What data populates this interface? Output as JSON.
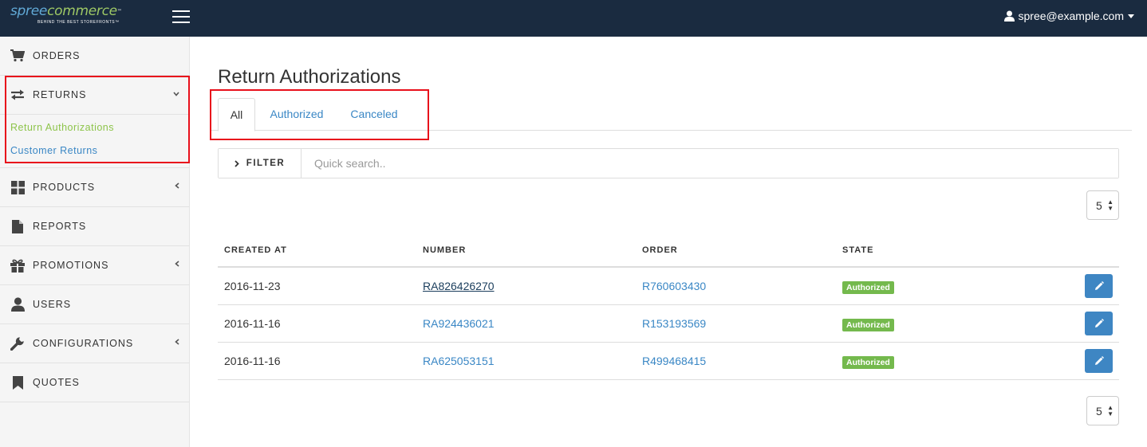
{
  "header": {
    "logo_a": "spree",
    "logo_b": "commerce",
    "logo_tm": "™",
    "logo_tagline": "BEHIND THE BEST STOREFRONTS™",
    "user_email": "spree@example.com"
  },
  "sidebar": {
    "orders": "ORDERS",
    "returns": "RETURNS",
    "return_authorizations": "Return Authorizations",
    "customer_returns": "Customer Returns",
    "products": "PRODUCTS",
    "reports": "REPORTS",
    "promotions": "PROMOTIONS",
    "users": "USERS",
    "configurations": "CONFIGURATIONS",
    "quotes": "QUOTES"
  },
  "main": {
    "title": "Return Authorizations",
    "tabs": [
      {
        "label": "All",
        "active": true
      },
      {
        "label": "Authorized",
        "active": false
      },
      {
        "label": "Canceled",
        "active": false
      }
    ],
    "filter_label": "FILTER",
    "search_placeholder": "Quick search..",
    "per_page_top": "5",
    "per_page_bottom": "5",
    "columns": [
      "CREATED AT",
      "NUMBER",
      "ORDER",
      "STATE"
    ],
    "rows": [
      {
        "created_at": "2016-11-23",
        "number": "RA826426270",
        "order": "R760603430",
        "state": "Authorized"
      },
      {
        "created_at": "2016-11-16",
        "number": "RA924436021",
        "order": "R153193569",
        "state": "Authorized"
      },
      {
        "created_at": "2016-11-16",
        "number": "RA625053151",
        "order": "R499468415",
        "state": "Authorized"
      }
    ]
  },
  "colors": {
    "navbar": "#1a2b40",
    "link": "#3a87c5",
    "active_green": "#8dc44a",
    "badge_green": "#74b94d",
    "highlight_red": "#e8101b",
    "edit_button": "#3e86c3"
  }
}
